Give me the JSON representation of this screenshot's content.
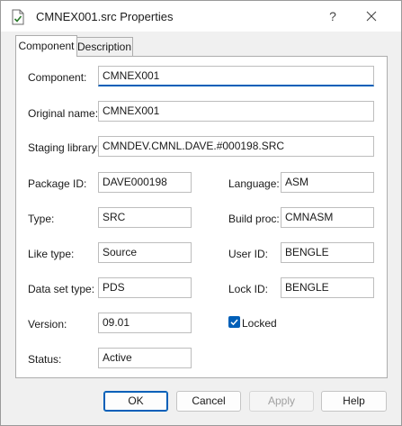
{
  "window": {
    "title": "CMNEX001.src Properties",
    "help_glyph": "?"
  },
  "tabs": [
    {
      "label": "Component",
      "active": true
    },
    {
      "label": "Description",
      "active": false
    }
  ],
  "fields": {
    "component": {
      "label": "Component:",
      "value": "CMNEX001"
    },
    "original_name": {
      "label": "Original name:",
      "value": "CMNEX001"
    },
    "staging_library": {
      "label": "Staging library:",
      "value": "CMNDEV.CMNL.DAVE.#000198.SRC"
    },
    "package_id": {
      "label": "Package ID:",
      "value": "DAVE000198"
    },
    "language": {
      "label": "Language:",
      "value": "ASM"
    },
    "type": {
      "label": "Type:",
      "value": "SRC"
    },
    "build_proc": {
      "label": "Build proc:",
      "value": "CMNASM"
    },
    "like_type": {
      "label": "Like type:",
      "value": "Source"
    },
    "user_id": {
      "label": "User ID:",
      "value": "BENGLE"
    },
    "data_set_type": {
      "label": "Data set type:",
      "value": "PDS"
    },
    "lock_id": {
      "label": "Lock ID:",
      "value": "BENGLE"
    },
    "version": {
      "label": "Version:",
      "value": "09.01"
    },
    "status": {
      "label": "Status:",
      "value": "Active"
    }
  },
  "locked": {
    "label": "Locked",
    "checked": true
  },
  "buttons": {
    "ok": "OK",
    "cancel": "Cancel",
    "apply": "Apply",
    "help": "Help"
  },
  "colors": {
    "accent": "#005fb8",
    "panel": "#ffffff",
    "chrome": "#f0f0f0"
  }
}
